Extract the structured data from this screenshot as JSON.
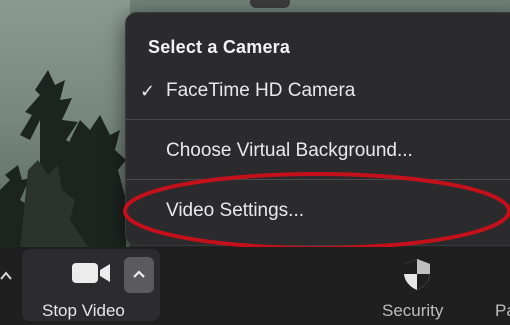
{
  "camera_menu": {
    "header": "Select a Camera",
    "selected_camera": "FaceTime HD Camera",
    "check_glyph": "✓",
    "items": [
      {
        "label": "Choose Virtual Background..."
      },
      {
        "label": "Video Settings..."
      }
    ]
  },
  "toolbar": {
    "stop_video_label": "Stop Video",
    "security_label": "Security",
    "participants_label_partial": "Pa",
    "left_caret": "^"
  },
  "icons": {
    "video": "video-camera-icon",
    "caret_up": "chevron-up-icon",
    "shield": "shield-icon"
  },
  "colors": {
    "menu_bg": "#2b2b2d",
    "annotation": "#c4101a",
    "toolbar_bg": "#1f1f20"
  }
}
